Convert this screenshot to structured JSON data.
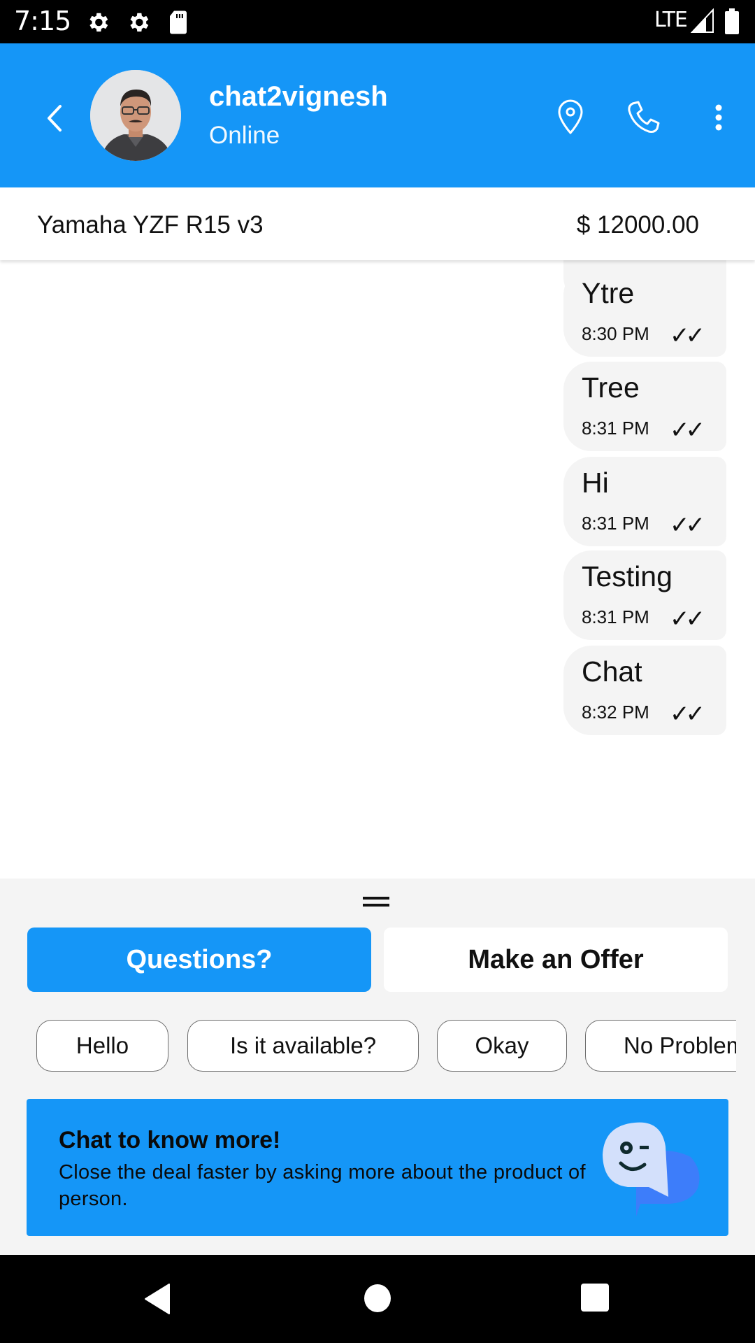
{
  "status_bar": {
    "time": "7:15",
    "icons_left": [
      "settings-icon",
      "settings-icon",
      "sd-card-icon"
    ],
    "network": "LTE",
    "icons_right": [
      "signal-icon",
      "battery-icon"
    ]
  },
  "header": {
    "contact_name": "chat2vignesh",
    "contact_status": "Online",
    "avatar": "contact-avatar-photo",
    "actions": [
      "location-pin-icon",
      "phone-icon",
      "more-vert-icon"
    ],
    "accent_color": "#1596f7"
  },
  "product": {
    "name": "Yamaha YZF R15 v3",
    "price": "$ 12000.00"
  },
  "messages": [
    {
      "text": "Ytre",
      "time": "8:30 PM",
      "status": "✓✓"
    },
    {
      "text": "Tree",
      "time": "8:31 PM",
      "status": "✓✓"
    },
    {
      "text": "Hi",
      "time": "8:31 PM",
      "status": "✓✓"
    },
    {
      "text": "Testing",
      "time": "8:31 PM",
      "status": "✓✓"
    },
    {
      "text": "Chat",
      "time": "8:32 PM",
      "status": "✓✓"
    }
  ],
  "bottom_sheet": {
    "tabs": [
      {
        "label": "Questions?",
        "active": true
      },
      {
        "label": "Make an Offer",
        "active": false
      }
    ],
    "quick_replies": [
      "Hello",
      "Is it available?",
      "Okay",
      "No Problem"
    ],
    "promo": {
      "title": "Chat to know more!",
      "body": "Close the deal faster by asking more about the product of person."
    }
  },
  "nav_bar": {
    "buttons": [
      "back",
      "home",
      "recents"
    ]
  }
}
